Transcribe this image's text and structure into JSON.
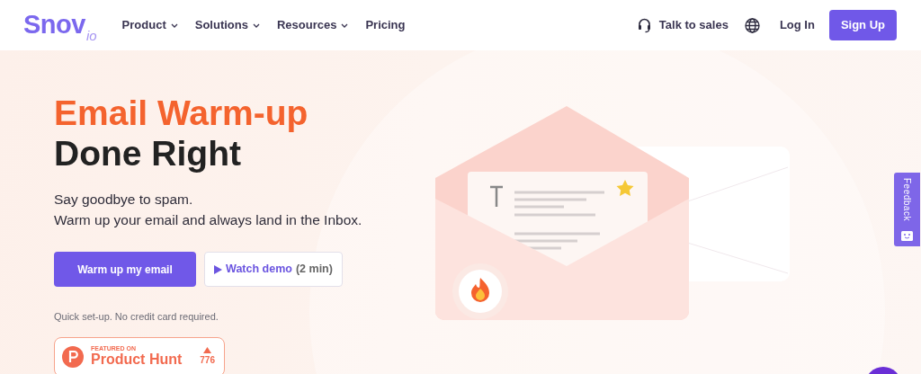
{
  "brand": {
    "name": "Snov",
    "suffix": "io"
  },
  "nav": [
    {
      "label": "Product",
      "dropdown": true
    },
    {
      "label": "Solutions",
      "dropdown": true
    },
    {
      "label": "Resources",
      "dropdown": true
    },
    {
      "label": "Pricing",
      "dropdown": false
    }
  ],
  "actions": {
    "talk_to_sales": "Talk to sales",
    "log_in": "Log In",
    "sign_up": "Sign Up"
  },
  "hero": {
    "title_highlight": "Email Warm-up",
    "title_rest": "Done Right",
    "subtitle": [
      "Say goodbye to spam.",
      "Warm up your email and always land in the Inbox."
    ],
    "primary_button": "Warm up my email",
    "demo_button": {
      "label": "Watch demo",
      "duration": "(2 min)"
    },
    "note": "Quick set-up. No credit card required.",
    "product_hunt": {
      "featured": "FEATURED ON",
      "name": "Product Hunt",
      "votes": "776"
    }
  },
  "feedback": "Feedback"
}
